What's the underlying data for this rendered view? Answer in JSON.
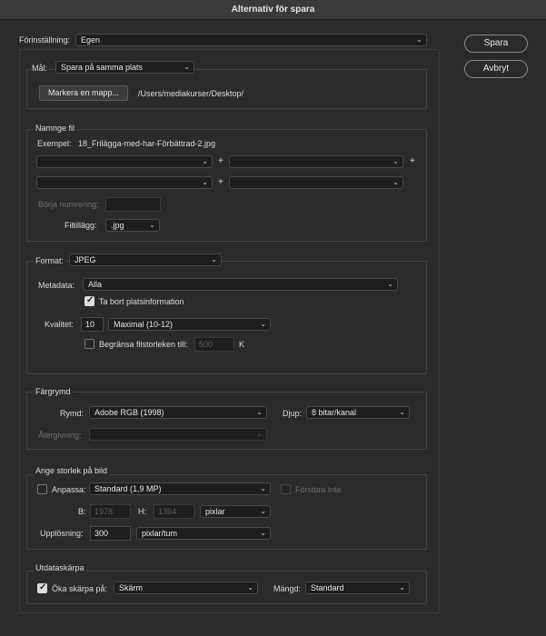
{
  "window": {
    "title": "Alternativ för spara"
  },
  "preset": {
    "label": "Förinställning:",
    "value": "Egen"
  },
  "buttons": {
    "save": "Spara",
    "cancel": "Avbryt"
  },
  "destination": {
    "label": "Mål:",
    "value": "Spara på samma plats",
    "select_folder": "Markera en mapp...",
    "path": "/Users/mediakurser/Desktop/"
  },
  "naming": {
    "header": "Namnge fil",
    "example_label": "Exempel:",
    "example_value": "18_Frilägga-med-har-Förbättrad-2.jpg",
    "plus": "+",
    "start_numbering_label": "Börja numrering:",
    "start_numbering_value": "",
    "extension_label": "Filtillägg:",
    "extension_value": ".jpg"
  },
  "format": {
    "label": "Format:",
    "value": "JPEG",
    "metadata_label": "Metadata:",
    "metadata_value": "Alla",
    "remove_location": "Ta bort platsinformation",
    "quality_label": "Kvalitet:",
    "quality_value": "10",
    "quality_preset": "Maximal  (10-12)",
    "limit_size": "Begränsa filstorleken till:",
    "limit_size_value": "500",
    "limit_size_unit": "K"
  },
  "color_space": {
    "header": "Färgrymd",
    "space_label": "Rymd:",
    "space_value": "Adobe RGB (1998)",
    "depth_label": "Djup:",
    "depth_value": "8 bitar/kanal",
    "intent_label": "Återgivning:",
    "intent_value": ""
  },
  "image_size": {
    "header": "Ange storlek på bild",
    "fit_label": "Anpassa:",
    "fit_value": "Standard (1,9 MP)",
    "no_enlarge": "Förstora inte",
    "w_label": "B:",
    "w_value": "1978",
    "h_label": "H:",
    "h_value": "1394",
    "unit_value": "pixlar",
    "resolution_label": "Upplösning:",
    "resolution_value": "300",
    "resolution_unit": "pixlar/tum"
  },
  "sharpening": {
    "header": "Utdataskärpa",
    "sharpen_label": "Öka skärpa på:",
    "sharpen_value": "Skärm",
    "amount_label": "Mängd:",
    "amount_value": "Standard"
  }
}
